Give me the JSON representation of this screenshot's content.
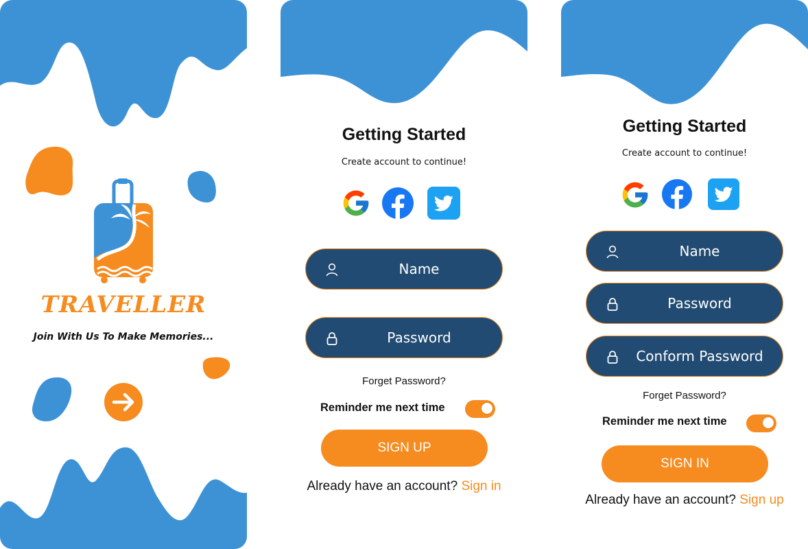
{
  "colors": {
    "primary_blue": "#3D92D6",
    "field_navy": "#214B72",
    "accent_orange": "#F68B1F",
    "text_dark": "#111111"
  },
  "splash": {
    "brand": "TRAVELLER",
    "tagline": "Join With Us To Make Memories...",
    "logo_icon": "luggage-palm-icon",
    "next_icon": "arrow-right-icon"
  },
  "signup": {
    "title": "Getting Started",
    "subtitle": "Create account to continue!",
    "social_icons": [
      "google-icon",
      "facebook-icon",
      "twitter-icon"
    ],
    "fields": [
      {
        "icon": "user-icon",
        "label": "Name"
      },
      {
        "icon": "lock-icon",
        "label": "Password"
      }
    ],
    "forgot": "Forget Password?",
    "remember_label": "Reminder me next time",
    "remember_on": true,
    "submit_label": "SIGN UP",
    "switch_prompt": "Already have an account?",
    "switch_link": "Sign in"
  },
  "signin": {
    "title": "Getting Started",
    "subtitle": "Create account to continue!",
    "social_icons": [
      "google-icon",
      "facebook-icon",
      "twitter-icon"
    ],
    "fields": [
      {
        "icon": "user-icon",
        "label": "Name"
      },
      {
        "icon": "lock-icon",
        "label": "Password"
      },
      {
        "icon": "lock-icon",
        "label": "Conform Password"
      }
    ],
    "forgot": "Forget Password?",
    "remember_label": "Reminder me next time",
    "remember_on": true,
    "submit_label": "SIGN IN",
    "switch_prompt": "Already have an account?",
    "switch_link": "Sign up"
  }
}
